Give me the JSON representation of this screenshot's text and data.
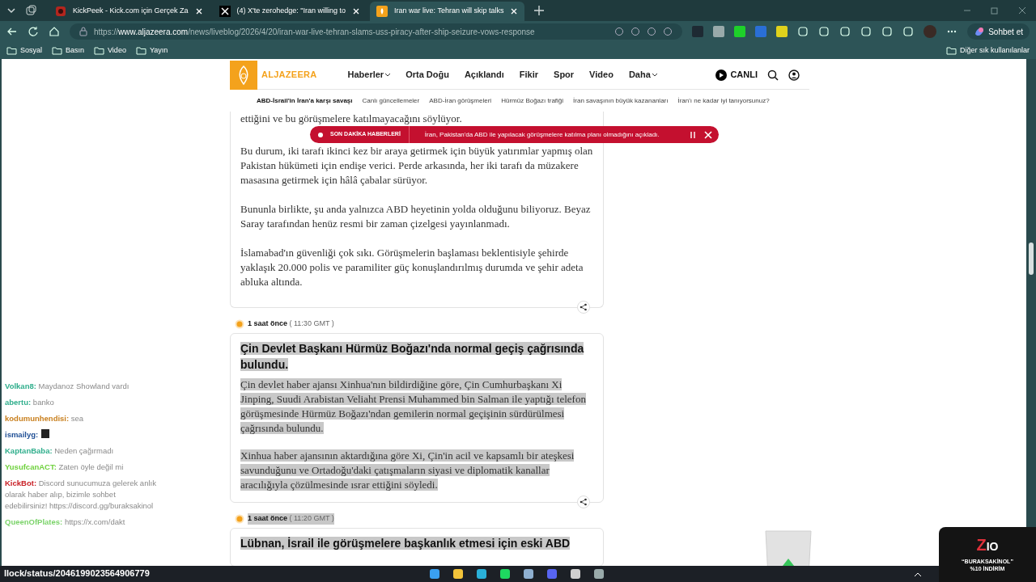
{
  "browser": {
    "tabs": [
      {
        "title": "KickPeek - Kick.com için Gerçek Za",
        "kind": "kick",
        "selected": false
      },
      {
        "title": "(4) X'te zerohedge: \"Iran willing to",
        "kind": "x",
        "selected": false
      },
      {
        "title": "Iran war live: Tehran will skip talks",
        "kind": "aj",
        "selected": true
      }
    ],
    "address": {
      "scheme": "https://",
      "host": "www.aljazeera.com",
      "path": "/news/liveblog/2026/4/20/iran-war-live-tehran-slams-uss-piracy-after-ship-seizure-vows-response"
    },
    "copilot_button": "Sohbet et",
    "bookmarks": [
      "Sosyal",
      "Basın",
      "Video",
      "Yayın"
    ],
    "other_bookmarks": "Diğer sık kullanılanlar"
  },
  "site": {
    "logo": "ALJAZEERA",
    "nav": [
      {
        "label": "Haberler",
        "dropdown": true
      },
      {
        "label": "Orta Doğu",
        "dropdown": false
      },
      {
        "label": "Açıklandı",
        "dropdown": false
      },
      {
        "label": "Fikir",
        "dropdown": false
      },
      {
        "label": "Spor",
        "dropdown": false
      },
      {
        "label": "Video",
        "dropdown": false
      },
      {
        "label": "Daha",
        "dropdown": true
      }
    ],
    "live_button": "CANLI",
    "subnav": [
      {
        "label": "ABD-İsrail'in İran'a karşı savaşı",
        "selected": true
      },
      {
        "label": "Canlı güncellemeler",
        "selected": false
      },
      {
        "label": "ABD-İran görüşmeleri",
        "selected": false
      },
      {
        "label": "Hürmüz Boğazı trafiği",
        "selected": false
      },
      {
        "label": "İran savaşının büyük kazananları",
        "selected": false
      },
      {
        "label": "İran'ı ne kadar iyi tanıyorsunuz?",
        "selected": false
      }
    ]
  },
  "breaking": {
    "label": "SON DAKİKA HABERLERİ",
    "text": "İran, Pakistan'da ABD ile yapılacak görüşmelere katılma planı olmadığını açıkladı."
  },
  "posts": [
    {
      "body_selected": false,
      "paragraphs": [
        "ettiğini ve bu görüşmelere katılmayacağını söylüyor.",
        "Bu durum, iki tarafı ikinci kez bir araya getirmek için büyük yatırımlar yapmış olan Pakistan hükümeti için endişe verici. Perde arkasında, her iki tarafı da müzakere masasına getirmek için hâlâ çabalar sürüyor.",
        "Bununla birlikte, şu anda yalnızca ABD heyetinin yolda olduğunu biliyoruz. Beyaz Saray tarafından henüz resmi bir zaman çizelgesi yayınlanmadı.",
        "İslamabad'ın güvenliği çok sıkı. Görüşmelerin başlaması beklentisiyle şehirde yaklaşık 20.000 polis ve paramiliter güç konuşlandırılmış durumda ve şehir adeta abluka altında."
      ]
    },
    {
      "time": "1 saat önce",
      "gmt": "( 11:30 GMT )",
      "time_selected": false,
      "title": "Çin Devlet Başkanı Hürmüz Boğazı'nda normal geçiş çağrısında bulundu.",
      "title_selected": true,
      "body_selected": true,
      "paragraphs": [
        "Çin devlet haber ajansı Xinhua'nın bildirdiğine göre, Çin Cumhurbaşkanı Xi Jinping, Suudi Arabistan Veliaht Prensi Muhammed bin Salman ile yaptığı telefon görüşmesinde Hürmüz Boğazı'ndan gemilerin normal geçişinin sürdürülmesi çağrısında bulundu.",
        "Xinhua haber ajansının aktardığına göre Xi, Çin'in acil ve kapsamlı bir ateşkesi savunduğunu ve Ortadoğu'daki çatışmaların siyasi ve diplomatik kanallar aracılığıyla çözülmesinde ısrar ettiğini söyledi."
      ]
    },
    {
      "time": "1 saat önce",
      "gmt": "( 11:20 GMT )",
      "time_selected": true,
      "title": "Lübnan, İsrail ile görüşmelere başkanlık etmesi için eski ABD",
      "title_selected": true
    }
  ],
  "chat": [
    {
      "user": "Volkan8:",
      "color": "#2fae8c",
      "text": "Maydanoz Showland vardı"
    },
    {
      "user": "abertu:",
      "color": "#2fae8c",
      "text": "banko"
    },
    {
      "user": "kodumunhendisi:",
      "color": "#c9801f",
      "text": "sea"
    },
    {
      "user": "ismailyg:",
      "color": "#1f4f95",
      "emote": true
    },
    {
      "user": "KaptanBaba:",
      "color": "#2fae8c",
      "text": "Neden çağırmadı"
    },
    {
      "user": "YusufcanACT:",
      "color": "#6fd13d",
      "text": "Zaten öyle değil mi"
    },
    {
      "user": "KickBot:",
      "color": "#c81e24",
      "text": "Discord sunucumuza gelerek anlık olarak haber alıp, bizimle sohbet edebilirsiniz! https://discord.gg/buraksakinol"
    },
    {
      "user": "QueenOfPlates:",
      "color": "#7bd36a",
      "text": "https://x.com/dakt"
    }
  ],
  "status_text": "llock/status/2046199023564906779",
  "ad": {
    "logo_red": "Z",
    "logo_white": "IO",
    "code": "“BURAKSAKİNOL”",
    "offer": "%10 İNDİRİM"
  }
}
